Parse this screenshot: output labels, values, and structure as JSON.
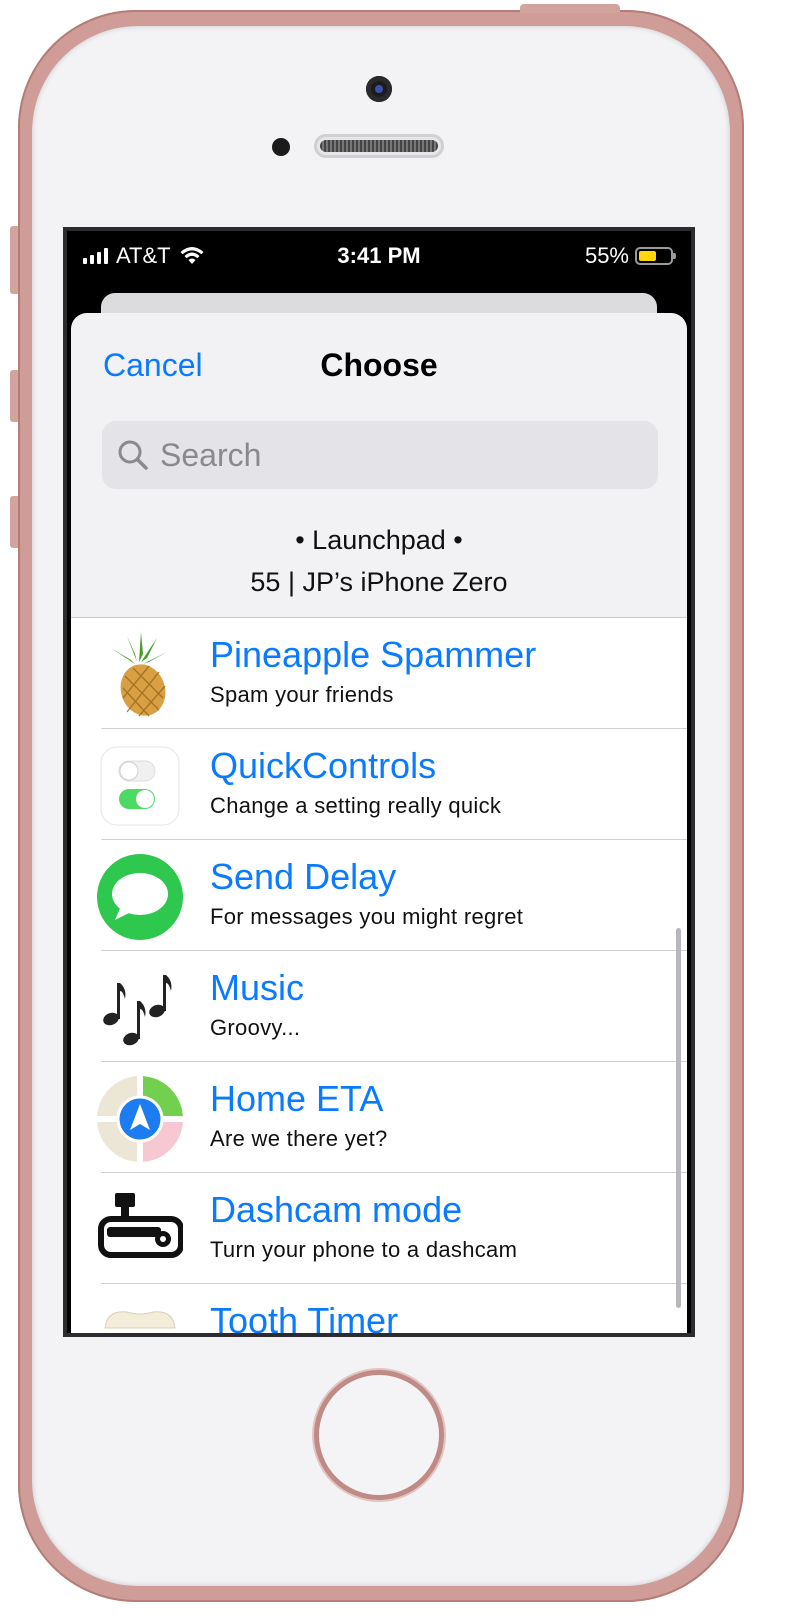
{
  "status_bar": {
    "carrier": "AT&T",
    "time": "3:41 PM",
    "battery": "55%",
    "battery_level": 0.55
  },
  "nav": {
    "cancel_label": "Cancel",
    "title": "Choose"
  },
  "search": {
    "placeholder": "Search"
  },
  "header": {
    "line1": "• Launchpad •",
    "line2": "55 | JP’s iPhone Zero"
  },
  "items": [
    {
      "name": "Pineapple Spammer",
      "subtitle": "Spam your friends",
      "icon": "pineapple-icon"
    },
    {
      "name": "QuickControls",
      "subtitle": "Change a setting really quick",
      "icon": "toggle-switches-icon"
    },
    {
      "name": "Send Delay",
      "subtitle": "For messages you might regret",
      "icon": "messages-icon"
    },
    {
      "name": "Music",
      "subtitle": "Groovy...",
      "icon": "music-notes-icon"
    },
    {
      "name": "Home ETA",
      "subtitle": "Are we there yet?",
      "icon": "maps-icon"
    },
    {
      "name": "Dashcam mode",
      "subtitle": "Turn your phone to a dashcam",
      "icon": "dashcam-icon"
    },
    {
      "name": "Tooth Timer",
      "subtitle": "",
      "icon": "tooth-icon"
    }
  ],
  "colors": {
    "accent": "#0a7aff",
    "device_frame": "#cf9c97"
  }
}
